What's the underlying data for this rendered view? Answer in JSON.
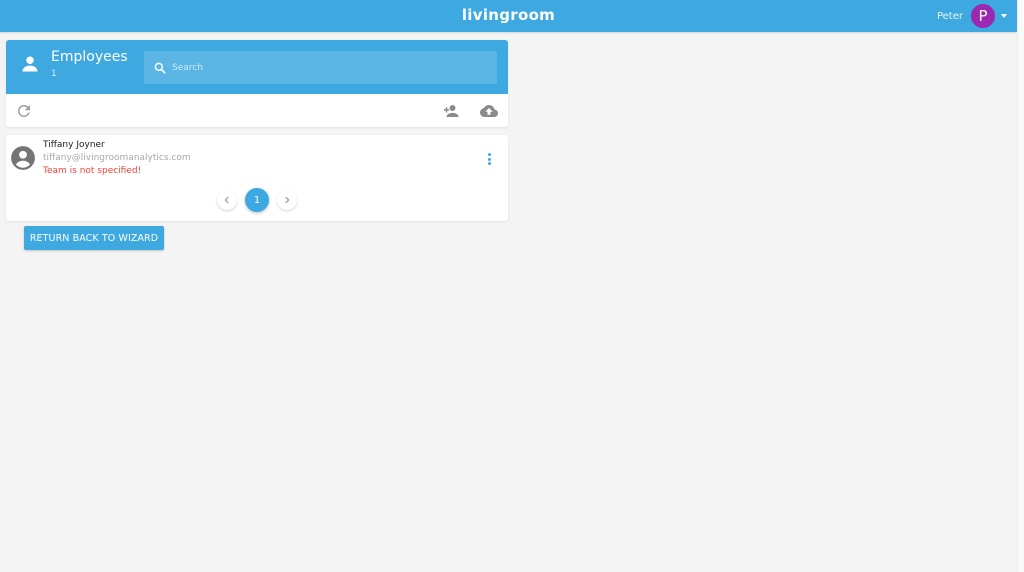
{
  "topbar": {
    "brand": "livingroom",
    "user_name": "Peter",
    "avatar_initial": "P",
    "avatar_color": "#9c27b0",
    "accent_color": "#3ea8e0"
  },
  "employees_panel": {
    "title": "Employees",
    "count": "1",
    "search_placeholder": "Search",
    "search_value": "",
    "toolbar_icons": [
      "refresh-icon",
      "add-user-icon",
      "cloud-upload-icon"
    ]
  },
  "employee_list": [
    {
      "name": "Tiffany Joyner",
      "email": "tiffany@livingroomanalytics.com",
      "warning": "Team is not specified!",
      "warning_color": "#f44336"
    }
  ],
  "pagination": {
    "current_page": "1"
  },
  "wizard_button_label": "RETURN BACK TO WIZARD"
}
